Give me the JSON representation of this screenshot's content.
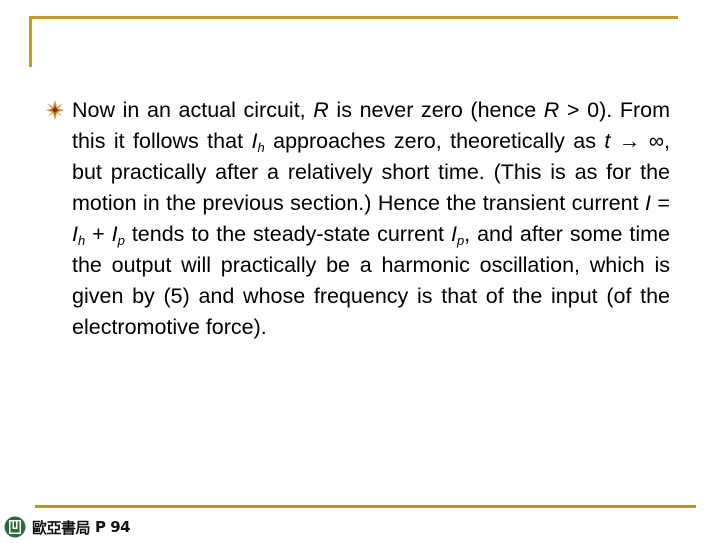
{
  "slide": {
    "decorations": {
      "accent_color": "#c49a22",
      "bottom_rule_color": "#b8942e"
    },
    "bullet": {
      "icon": "starburst-bullet-icon",
      "segments": {
        "s1": "Now in an actual circuit, ",
        "R1": "R",
        "s2": " is never zero (hence ",
        "R2": "R",
        "s3": " > 0). From this it follows that ",
        "Ih1": "I",
        "Ih1_sub": "h",
        "s4": " approaches zero, theoretically as ",
        "t": "t",
        "s5": " → ∞, but practically after a relatively short time. (This is as for the motion in the previous section.) Hence the transient current ",
        "I": "I",
        "s6": " = ",
        "Ih2": "I",
        "Ih2_sub": "h",
        "s7": " + ",
        "Ip1": "I",
        "Ip1_sub": "p",
        "s8": " tends to the steady-state current ",
        "Ip2": "I",
        "Ip2_sub": "p",
        "s9": ", and after some time the output will practically be a harmonic oscillation, which is given by (5) and whose frequency is that of the input (of the electromotive force)."
      }
    },
    "footer": {
      "logo_icon": "publisher-logo-icon",
      "publisher": "歐亞書局",
      "page_label": "P 94"
    }
  }
}
